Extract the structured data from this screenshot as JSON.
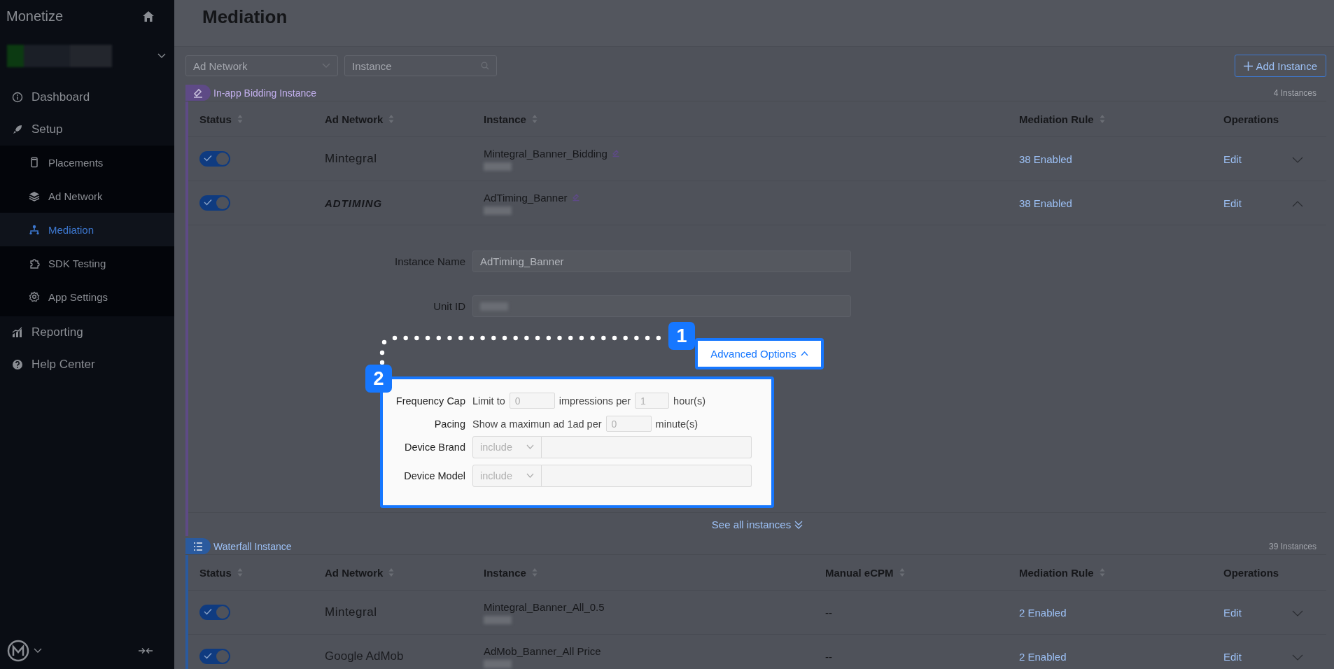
{
  "sidebar": {
    "title": "Monetize",
    "items": [
      {
        "label": "Dashboard",
        "selected": false
      },
      {
        "label": "Setup",
        "selected": false,
        "children": [
          {
            "label": "Placements",
            "selected": false
          },
          {
            "label": "Ad Network",
            "selected": false
          },
          {
            "label": "Mediation",
            "selected": true
          },
          {
            "label": "SDK Testing",
            "selected": false
          },
          {
            "label": "App Settings",
            "selected": false
          }
        ]
      },
      {
        "label": "Reporting",
        "selected": false
      },
      {
        "label": "Help Center",
        "selected": false
      }
    ]
  },
  "page_title": "Mediation",
  "filters": {
    "ad_network": {
      "placeholder": "Ad Network"
    },
    "instance": {
      "placeholder": "Instance"
    }
  },
  "add_button": {
    "label": "Add Instance"
  },
  "sections": [
    {
      "kind": "bidding",
      "title": "In-app Bidding Instance",
      "count": "4 Instances",
      "color": "#5e4a86",
      "columns": [
        {
          "label": "Status",
          "sortable": true
        },
        {
          "label": "Ad Network",
          "sortable": true
        },
        {
          "label": "Instance",
          "sortable": true
        },
        {
          "label": "Mediation Rule",
          "sortable": true
        },
        {
          "label": "Operations",
          "sortable": false
        }
      ],
      "rows": [
        {
          "on": true,
          "network": "Mintegral",
          "instance": "Mintegral_Banner_Bidding",
          "rule": "38 Enabled",
          "action": "Edit",
          "expanded": false
        },
        {
          "on": true,
          "network": "ADTIMING",
          "instance": "AdTiming_Banner",
          "rule": "38 Enabled",
          "action": "Edit",
          "expanded": true
        }
      ],
      "detail": {
        "fields": [
          {
            "label": "Instance Name",
            "value": "AdTiming_Banner",
            "disabled": true
          },
          {
            "label": "Unit ID",
            "disabled": true
          }
        ],
        "advanced": {
          "label": "Advanced Options",
          "expanded": true
        },
        "options": [
          {
            "label": "Frequency Cap",
            "parts": [
              {
                "kind": "text",
                "text": "Limit to"
              },
              {
                "kind": "input",
                "placeholder": "0"
              },
              {
                "kind": "text",
                "text": "impressions per"
              },
              {
                "kind": "input",
                "placeholder": "1"
              },
              {
                "kind": "text",
                "text": "hour(s)"
              }
            ]
          },
          {
            "label": "Pacing",
            "parts": [
              {
                "kind": "text",
                "text": "Show a maximun ad 1ad per"
              },
              {
                "kind": "input",
                "placeholder": "0"
              },
              {
                "kind": "text",
                "text": "minute(s)"
              }
            ]
          },
          {
            "label": "Device Brand",
            "parts": [
              {
                "kind": "select",
                "value": "include"
              },
              {
                "kind": "field"
              }
            ]
          },
          {
            "label": "Device Model",
            "parts": [
              {
                "kind": "select",
                "value": "include"
              },
              {
                "kind": "field"
              }
            ]
          }
        ]
      },
      "footer": "See all instances"
    },
    {
      "kind": "waterfall",
      "title": "Waterfall Instance",
      "count": "39 Instances",
      "color": "#2a5a9e",
      "columns": [
        {
          "label": "Status",
          "sortable": true
        },
        {
          "label": "Ad Network",
          "sortable": true
        },
        {
          "label": "Instance",
          "sortable": true
        },
        {
          "label": "Manual eCPM",
          "sortable": true
        },
        {
          "label": "Mediation Rule",
          "sortable": true
        },
        {
          "label": "Operations",
          "sortable": false
        }
      ],
      "rows": [
        {
          "on": true,
          "network": "Mintegral",
          "instance": "Mintegral_Banner_All_0.5",
          "ecpm": "--",
          "rule": "2 Enabled",
          "action": "Edit",
          "expanded": false
        },
        {
          "on": true,
          "network": "Google AdMob",
          "instance": "AdMob_Banner_All Price",
          "ecpm": "--",
          "rule": "2 Enabled",
          "action": "Edit",
          "expanded": false
        }
      ]
    }
  ],
  "callouts": [
    {
      "label": "1"
    },
    {
      "label": "2"
    }
  ]
}
